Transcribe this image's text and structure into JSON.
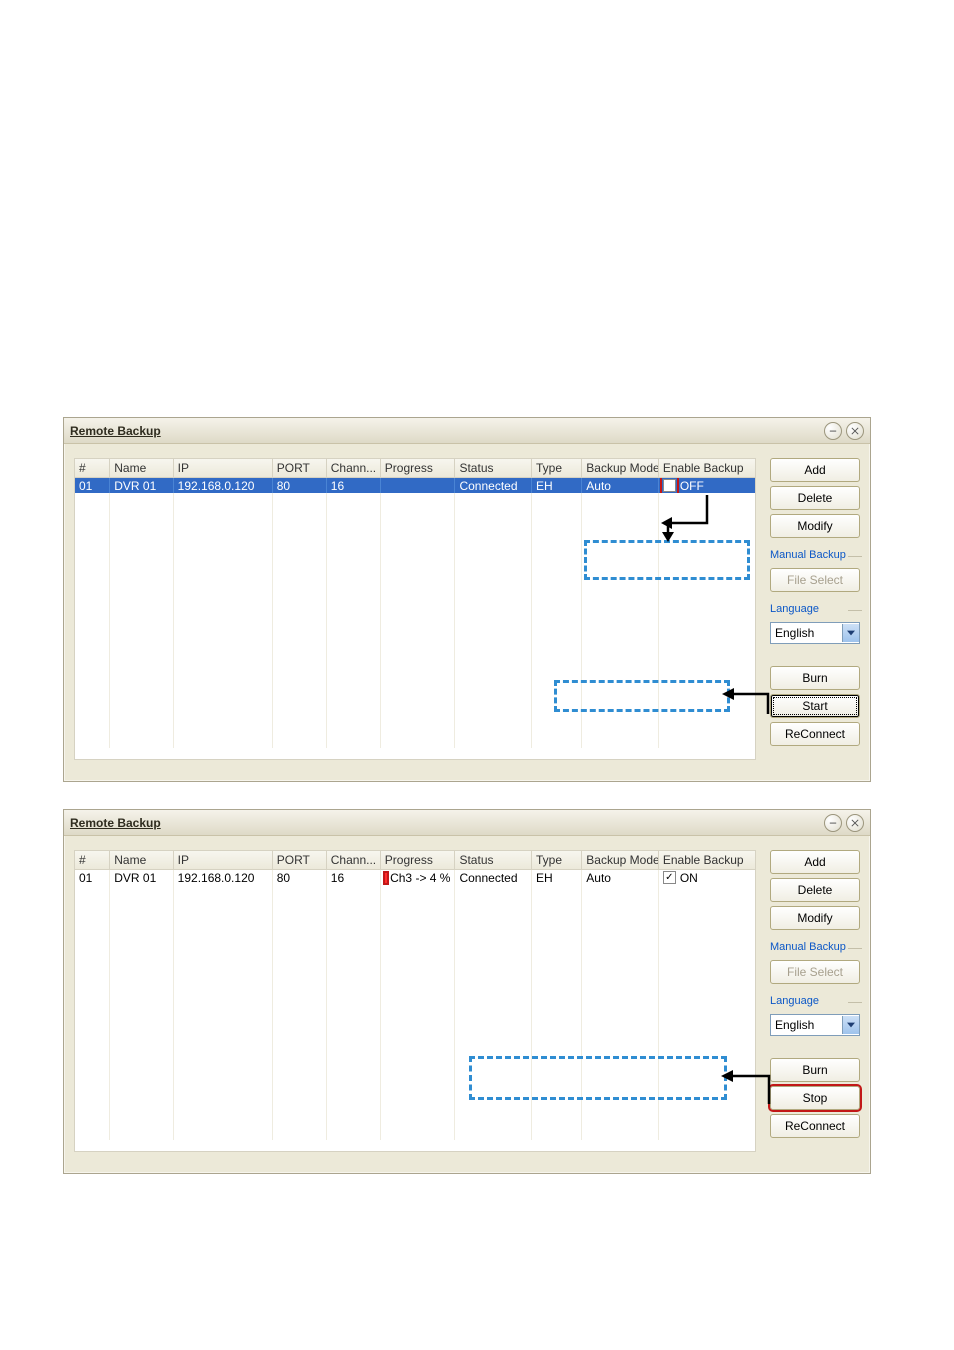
{
  "windows": [
    {
      "title": "Remote Backup",
      "columns": [
        "#",
        "Name",
        "IP",
        "PORT",
        "Chann...",
        "Progress",
        "Status",
        "Type",
        "Backup Mode",
        "Enable Backup"
      ],
      "row": {
        "num": "01",
        "name": "DVR 01",
        "ip": "192.168.0.120",
        "port": "80",
        "channels": "16",
        "progress": "",
        "status": "Connected",
        "type": "EH",
        "mode": "Auto",
        "enable": "OFF",
        "enable_checked": false,
        "selected": true,
        "enable_red": true,
        "show_progress_block": false
      },
      "buttons": {
        "add": "Add",
        "delete": "Delete",
        "modify": "Modify",
        "fileselect": "File Select",
        "burn": "Burn",
        "action": "Start",
        "reconnect": "ReConnect"
      },
      "manual_backup_label": "Manual Backup",
      "language_label": "Language",
      "language_value": "English",
      "action_highlight": true
    },
    {
      "title": "Remote Backup",
      "columns": [
        "#",
        "Name",
        "IP",
        "PORT",
        "Chann...",
        "Progress",
        "Status",
        "Type",
        "Backup Mode",
        "Enable Backup"
      ],
      "row": {
        "num": "01",
        "name": "DVR 01",
        "ip": "192.168.0.120",
        "port": "80",
        "channels": "16",
        "progress": "Ch3 -> 4 %",
        "status": "Connected",
        "type": "EH",
        "mode": "Auto",
        "enable": "ON",
        "enable_checked": true,
        "selected": false,
        "enable_red": false,
        "show_progress_block": true
      },
      "buttons": {
        "add": "Add",
        "delete": "Delete",
        "modify": "Modify",
        "fileselect": "File Select",
        "burn": "Burn",
        "action": "Stop",
        "reconnect": "ReConnect"
      },
      "manual_backup_label": "Manual Backup",
      "language_label": "Language",
      "language_value": "English",
      "action_highlight": true
    }
  ]
}
